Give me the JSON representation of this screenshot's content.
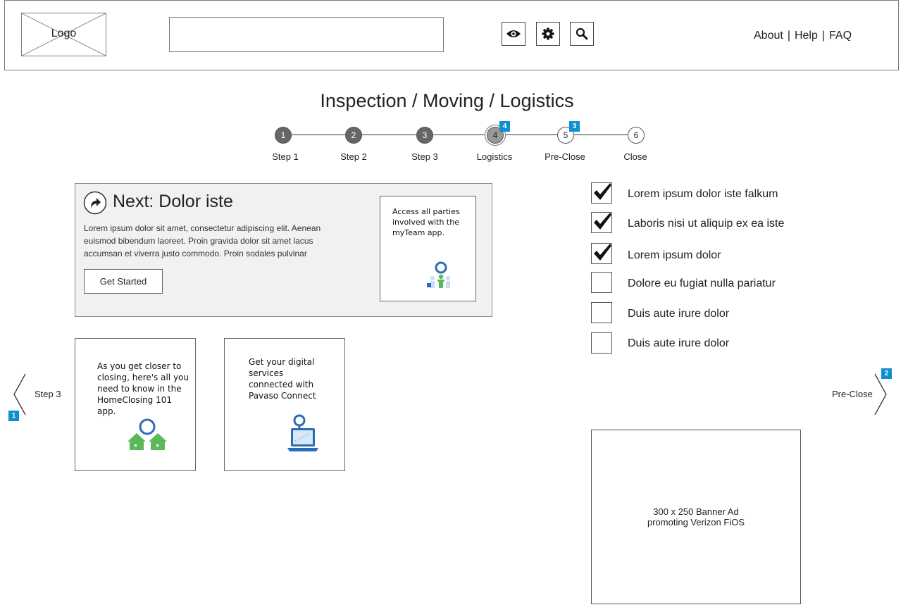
{
  "header": {
    "logo_label": "Logo",
    "search_value": "",
    "icons": [
      "eye-icon",
      "gear-icon",
      "search-icon"
    ],
    "links": [
      "About",
      "Help",
      "FAQ"
    ],
    "link_separator": "|"
  },
  "page_title": "Inspection / Moving / Logistics",
  "stepper": {
    "steps": [
      {
        "number": "1",
        "label": "Step 1",
        "state": "done"
      },
      {
        "number": "2",
        "label": "Step 2",
        "state": "done"
      },
      {
        "number": "3",
        "label": "Step 3",
        "state": "done"
      },
      {
        "number": "4",
        "label": "Logistics",
        "state": "current",
        "badge": "4"
      },
      {
        "number": "5",
        "label": "Pre-Close",
        "state": "todo",
        "badge": "3"
      },
      {
        "number": "6",
        "label": "Close",
        "state": "todo"
      }
    ]
  },
  "next_card": {
    "title": "Next: Dolor iste",
    "body": "Lorem ipsum dolor sit amet, consectetur adipiscing elit. Aenean euismod bibendum laoreet. Proin gravida dolor sit amet lacus accumsan et viverra justo commodo. Proin sodales pulvinar",
    "button_label": "Get Started",
    "promo_text": "Access all parties involved with the myTeam app."
  },
  "tiles": [
    {
      "text": "As you get closer to closing, here's all you need to know in the HomeClosing 101 app.",
      "icon": "houses-icon"
    },
    {
      "text": "Get your digital services connected with Pavaso Connect",
      "icon": "laptop-icon"
    }
  ],
  "checklist": [
    {
      "label": "Lorem ipsum dolor iste falkum",
      "checked": true
    },
    {
      "label": "Laboris nisi ut aliquip ex ea iste",
      "checked": true
    },
    {
      "label": "Lorem ipsum dolor",
      "checked": true
    },
    {
      "label": "Dolore eu fugiat nulla pariatur",
      "checked": false
    },
    {
      "label": "Duis aute irure dolor",
      "checked": false
    },
    {
      "label": "Duis aute irure dolor",
      "checked": false
    }
  ],
  "side_nav": {
    "prev_label": "Step 3",
    "prev_badge": "1",
    "next_label": "Pre-Close",
    "next_badge": "2"
  },
  "banner": {
    "line1": "300 x 250 Banner Ad",
    "line2": "promoting Verizon FiOS"
  },
  "colors": {
    "badge": "#0e8fcf",
    "card_background": "#f1f1f1",
    "step_done": "#666666",
    "step_current": "#999999",
    "icon_green": "#5cb85c",
    "icon_blue": "#2a6db5"
  }
}
